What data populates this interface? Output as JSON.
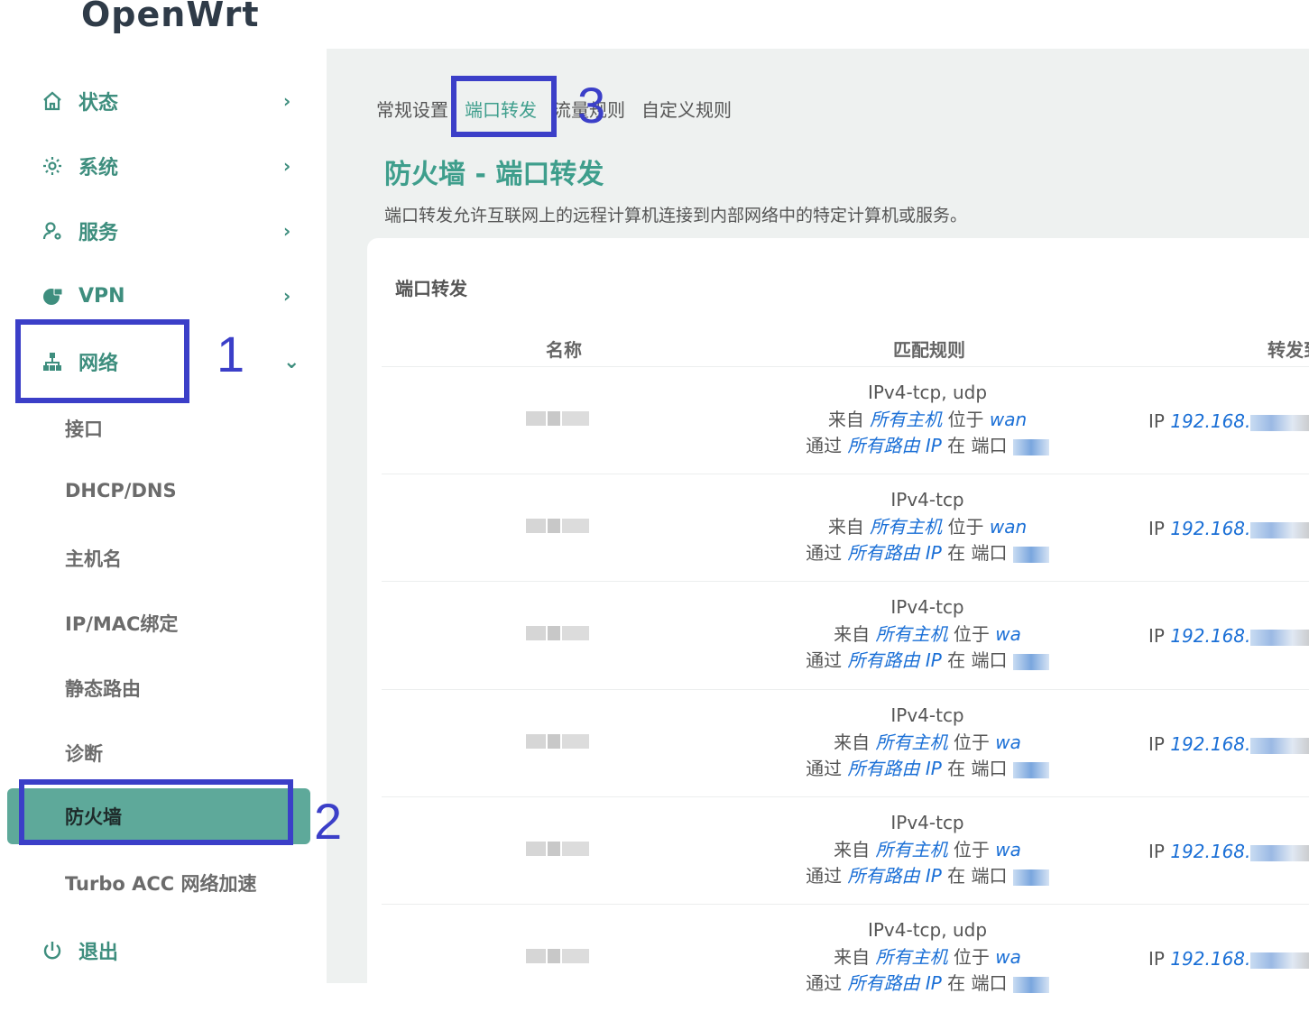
{
  "app": {
    "title": "OpenWrt"
  },
  "sidebar": {
    "items": [
      {
        "label": "状态",
        "icon": "home-icon",
        "chevron": "›"
      },
      {
        "label": "系统",
        "icon": "gear-icon",
        "chevron": "›"
      },
      {
        "label": "服务",
        "icon": "user-gear-icon",
        "chevron": "›"
      },
      {
        "label": "VPN",
        "icon": "globe-lock-icon",
        "chevron": "›"
      },
      {
        "label": "网络",
        "icon": "network-tree-icon",
        "chevron": "⌄"
      }
    ],
    "subitems": [
      "接口",
      "DHCP/DNS",
      "主机名",
      "IP/MAC绑定",
      "静态路由",
      "诊断",
      "防火墙",
      "Turbo ACC 网络加速"
    ],
    "active_subitem": "防火墙",
    "logout": {
      "label": "退出",
      "icon": "power-icon"
    }
  },
  "tabs": [
    "常规设置",
    "端口转发",
    "流量规则",
    "自定义规则"
  ],
  "active_tab": "端口转发",
  "page": {
    "title": "防火墙 - 端口转发",
    "description": "端口转发允许互联网上的远程计算机连接到内部网络中的特定计算机或服务。"
  },
  "table": {
    "section_title": "端口转发",
    "headers": [
      "名称",
      "匹配规则",
      "转发到"
    ],
    "rows": [
      {
        "proto": "IPv4-tcp, udp",
        "from_word": "来自",
        "from_host": "所有主机",
        "at_word": "位于",
        "zone": "wan",
        "via_word": "通过",
        "via_ip": "所有路由 IP",
        "port_word": "在 端口",
        "fwd_ip_prefix": "IP",
        "fwd_ip": "192.168."
      },
      {
        "proto": "IPv4-tcp",
        "from_word": "来自",
        "from_host": "所有主机",
        "at_word": "位于",
        "zone": "wan",
        "via_word": "通过",
        "via_ip": "所有路由 IP",
        "port_word": "在 端口",
        "fwd_ip_prefix": "IP",
        "fwd_ip": "192.168."
      },
      {
        "proto": "IPv4-tcp",
        "from_word": "来自",
        "from_host": "所有主机",
        "at_word": "位于",
        "zone": "wa",
        "via_word": "通过",
        "via_ip": "所有路由 IP",
        "port_word": "在 端口",
        "fwd_ip_prefix": "IP",
        "fwd_ip": "192.168."
      },
      {
        "proto": "IPv4-tcp",
        "from_word": "来自",
        "from_host": "所有主机",
        "at_word": "位于",
        "zone": "wa",
        "via_word": "通过",
        "via_ip": "所有路由 IP",
        "port_word": "在 端口",
        "fwd_ip_prefix": "IP",
        "fwd_ip": "192.168."
      },
      {
        "proto": "IPv4-tcp",
        "from_word": "来自",
        "from_host": "所有主机",
        "at_word": "位于",
        "zone": "wa",
        "via_word": "通过",
        "via_ip": "所有路由 IP",
        "port_word": "在 端口",
        "fwd_ip_prefix": "IP",
        "fwd_ip": "192.168."
      },
      {
        "proto": "IPv4-tcp, udp",
        "from_word": "来自",
        "from_host": "所有主机",
        "at_word": "位于",
        "zone": "wa",
        "via_word": "通过",
        "via_ip": "所有路由 IP",
        "port_word": "在 端口",
        "fwd_ip_prefix": "IP",
        "fwd_ip": "192.168."
      }
    ]
  },
  "annotations": [
    "1",
    "2",
    "3"
  ],
  "colors": {
    "accent": "#3e9e8c",
    "active_bg": "#5ea99a",
    "annotation": "#3b3fc8",
    "link": "#1a6fd6"
  }
}
